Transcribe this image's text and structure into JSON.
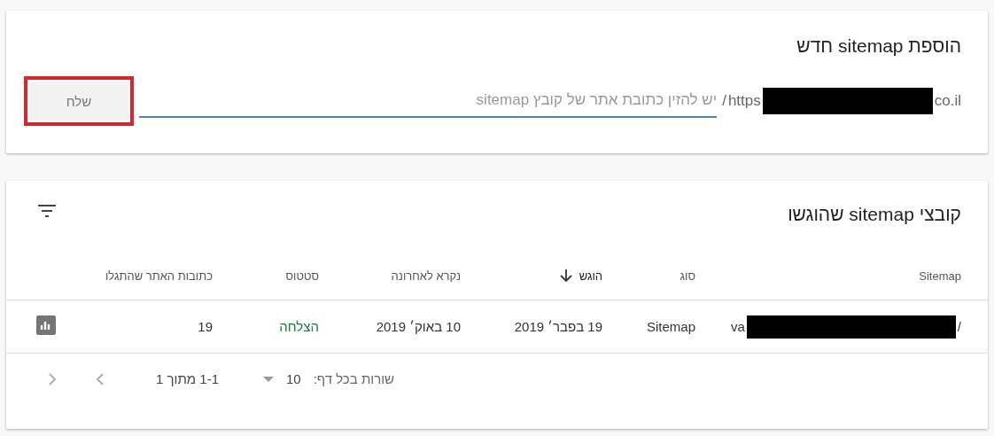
{
  "add_card": {
    "title": "הוספת sitemap חדש",
    "url_prefix_end": "co.il",
    "url_prefix_start": "https",
    "url_slash": "/",
    "placeholder": "יש להזין כתובת אתר של קובץ sitemap",
    "submit": "שלח",
    "submit_highlighted": true
  },
  "list_card": {
    "title": "קובצי sitemap שהוגשו",
    "columns": [
      {
        "label": "Sitemap",
        "sorted": false
      },
      {
        "label": "סוג",
        "sorted": false
      },
      {
        "label": "הוגש",
        "sorted": true
      },
      {
        "label": "נקרא לאחרונה",
        "sorted": false
      },
      {
        "label": "סטטוס",
        "sorted": false
      },
      {
        "label": "כתובות האתר שהתגלו",
        "sorted": false
      }
    ],
    "rows": [
      {
        "sitemap_start": "/",
        "sitemap_end": "va",
        "type": "Sitemap",
        "submitted": "19 בפבר׳ 2019",
        "last_read": "10 באוק׳ 2019",
        "status": "הצלחה",
        "color": "#188038",
        "discovered": "19"
      }
    ],
    "footer": {
      "rows_label": "שורות בכל דף:",
      "rows_value": "10",
      "range": "1-1 מתוך 1"
    }
  }
}
